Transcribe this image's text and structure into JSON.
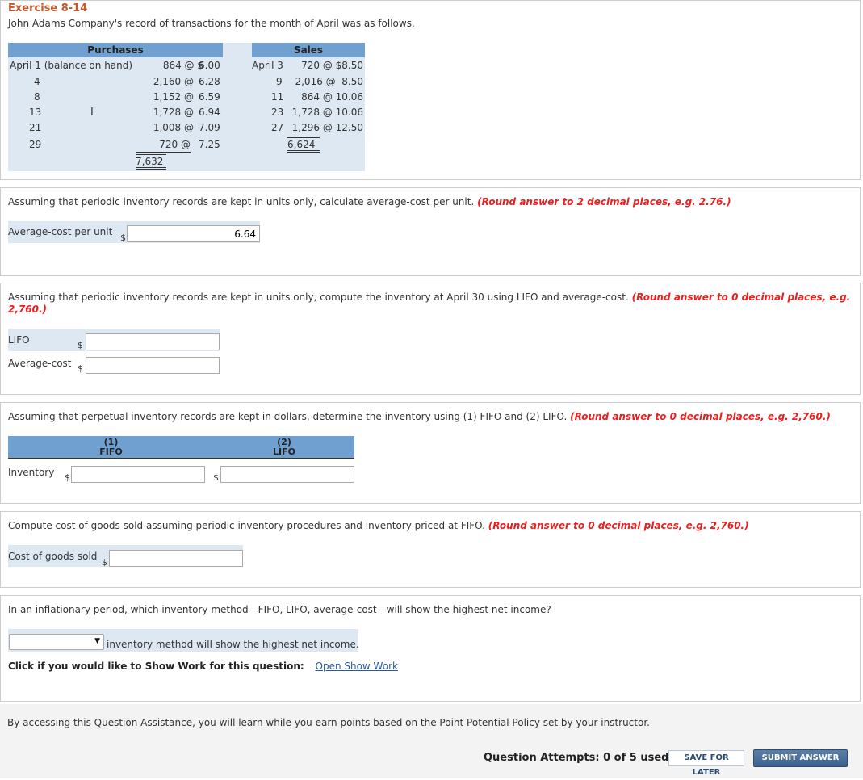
{
  "exercise": {
    "title": "Exercise 8-14",
    "intro": "John Adams Company's record of transactions for the month of April was as follows."
  },
  "table": {
    "purchases_header": "Purchases",
    "sales_header": "Sales",
    "purchases": [
      {
        "date": "April 1 (balance on hand)",
        "units": "864 @ $",
        "price": "6.00"
      },
      {
        "date": "4",
        "units": "2,160 @",
        "price": "6.28"
      },
      {
        "date": "8",
        "units": "1,152 @",
        "price": "6.59"
      },
      {
        "date": "13",
        "units": "1,728 @",
        "price": "6.94"
      },
      {
        "date": "21",
        "units": "1,008 @",
        "price": "7.09"
      },
      {
        "date": "29",
        "units": "720 @",
        "price": "7.25"
      }
    ],
    "purchases_total": "7,632",
    "sales": [
      {
        "date": "April 3",
        "value": "720 @ $8.50"
      },
      {
        "date": "9",
        "value": "2,016 @  8.50"
      },
      {
        "date": "11",
        "value": "864 @ 10.06"
      },
      {
        "date": "23",
        "value": "1,728 @ 10.06"
      },
      {
        "date": "27",
        "value": "1,296 @ 12.50"
      }
    ],
    "sales_total": "6,624"
  },
  "q1": {
    "prompt": "Assuming that periodic inventory records are kept in units only, calculate average-cost per unit.",
    "hint": "(Round answer to 2 decimal places, e.g. 2.76.)",
    "label": "Average-cost per unit",
    "currency": "$",
    "value": "6.64"
  },
  "q2": {
    "prompt": "Assuming that periodic inventory records are kept in units only, compute the inventory at April 30 using LIFO and average-cost.",
    "hint_line1": "(Round answer to 0 decimal places, e.g.",
    "hint_line2": "2,760.)",
    "lifo_label": "LIFO",
    "avg_label": "Average-cost",
    "currency": "$",
    "lifo_value": "",
    "avg_value": ""
  },
  "q3": {
    "prompt": "Assuming that perpetual inventory records are kept in dollars, determine the inventory using (1) FIFO and (2) LIFO.",
    "hint": "(Round answer to 0 decimal places, e.g. 2,760.)",
    "col1_num": "(1)",
    "col1_name": "FIFO",
    "col2_num": "(2)",
    "col2_name": "LIFO",
    "row_label": "Inventory",
    "currency": "$",
    "fifo_value": "",
    "lifo_value": ""
  },
  "q4": {
    "prompt": "Compute cost of goods sold assuming periodic inventory procedures and inventory priced at FIFO.",
    "hint": "(Round answer to 0 decimal places, e.g. 2,760.)",
    "label": "Cost of goods sold",
    "currency": "$",
    "value": ""
  },
  "q5": {
    "prompt": "In an inflationary period, which inventory method—FIFO, LIFO, average-cost—will show the highest net income?",
    "select_value": "",
    "suffix": "inventory method will show the highest net income.",
    "show_work_label": "Click if you would like to Show Work for this question:",
    "show_work_link": "Open Show Work"
  },
  "footer": {
    "assistance": "By accessing this Question Assistance, you will learn while you earn points based on the Point Potential Policy set by your instructor.",
    "attempts": "Question Attempts: 0 of 5 used",
    "save_label": "SAVE FOR LATER",
    "submit_label": "SUBMIT ANSWER"
  },
  "colors": {
    "title": "#c8572a",
    "hint_red": "#e8201f",
    "table_header": "#6fa0d0",
    "table_body": "#dde8f3",
    "link": "#2a5a9a",
    "submit_button": "#3e6290"
  },
  "icons": {
    "select_arrow": "chevron-down-icon",
    "cursor": "text-cursor-icon"
  }
}
